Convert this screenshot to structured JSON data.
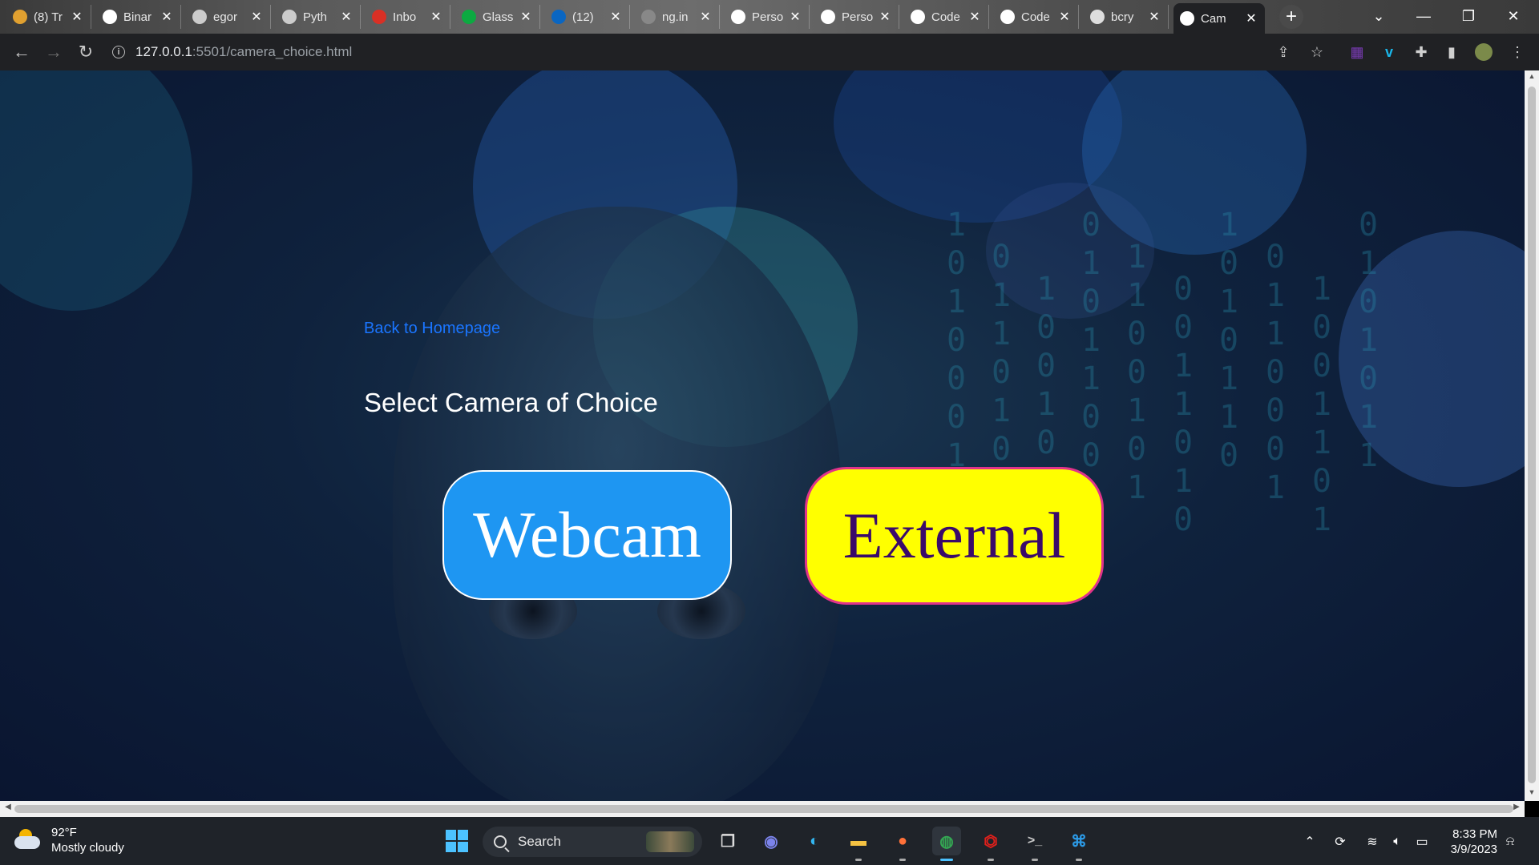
{
  "browser": {
    "tabs": [
      {
        "label": "(8) Tr",
        "icon": "feather-icon",
        "color": "#e0a030"
      },
      {
        "label": "Binar",
        "icon": "medium-icon",
        "color": "#ffffff"
      },
      {
        "label": "egor",
        "icon": "github-icon",
        "color": "#cccccc"
      },
      {
        "label": "Pyth",
        "icon": "github-icon",
        "color": "#cccccc"
      },
      {
        "label": "Inbo",
        "icon": "gmail-icon",
        "color": "#d93025"
      },
      {
        "label": "Glass",
        "icon": "glassdoor-icon",
        "color": "#0caa41"
      },
      {
        "label": "(12)",
        "icon": "linkedin-icon",
        "color": "#0a66c2"
      },
      {
        "label": "ng.in",
        "icon": "loading-icon",
        "color": "#888888"
      },
      {
        "label": "Perso",
        "icon": "globe-icon",
        "color": "#ffffff"
      },
      {
        "label": "Perso",
        "icon": "globe-icon",
        "color": "#ffffff"
      },
      {
        "label": "Code",
        "icon": "globe-icon",
        "color": "#ffffff"
      },
      {
        "label": "Code",
        "icon": "globe-icon",
        "color": "#ffffff"
      },
      {
        "label": "bcry",
        "icon": "package-icon",
        "color": "#dddddd"
      },
      {
        "label": "Cam",
        "icon": "globe-icon",
        "color": "#ffffff",
        "active": true
      }
    ],
    "url_host": "127.0.0.1",
    "url_path": ":5501/camera_choice.html"
  },
  "page": {
    "back_link": "Back to Homepage",
    "heading": "Select Camera of Choice",
    "webcam_label": "Webcam",
    "external_label": "External",
    "binary_columns": [
      "1010001",
      "0110101",
      "1001011",
      "0101100",
      "1100101",
      "0011010",
      "1010110",
      "0110001",
      "1001101",
      "0101011"
    ]
  },
  "taskbar": {
    "temperature": "92°F",
    "weather": "Mostly cloudy",
    "search_label": "Search",
    "time": "8:33 PM",
    "date": "3/9/2023"
  }
}
